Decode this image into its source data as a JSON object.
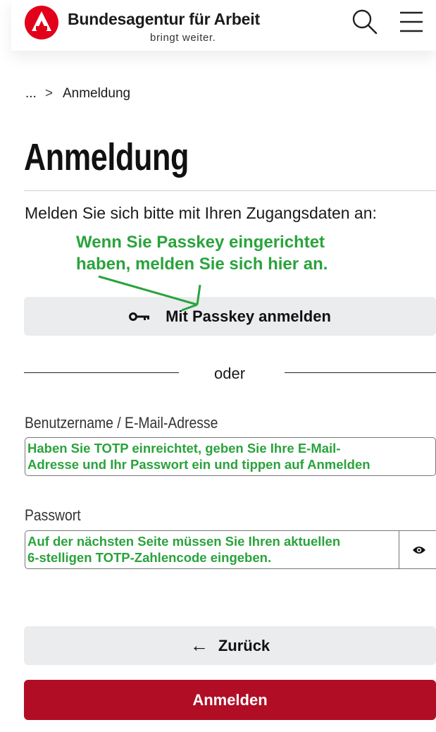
{
  "header": {
    "brand_name": "Bundesagentur für Arbeit",
    "brand_tagline": "bringt weiter.",
    "logo_icon": "ba-logo-icon",
    "search_icon": "search-icon",
    "menu_icon": "hamburger-menu-icon",
    "brand_color": "#e2001a"
  },
  "breadcrumb": {
    "ellipsis": "...",
    "separator": ">",
    "current": "Anmeldung"
  },
  "page": {
    "title": "Anmeldung",
    "intro": "Melden Sie sich bitte mit Ihren Zugangsdaten an:"
  },
  "annotations": {
    "passkey_line1": "Wenn Sie Passkey eingerichtet",
    "passkey_line2": "haben, melden Sie sich hier an.",
    "user_line1": "Haben Sie TOTP einreichtet, geben Sie Ihre E-Mail-",
    "user_line2": "Adresse und Ihr Passwort ein und tippen auf Anmelden",
    "pass_line1": "Auf der nächsten Seite müssen Sie Ihren aktuellen",
    "pass_line2": "6-stelligen TOTP-Zahlencode eingeben.",
    "annotation_color": "#2aa33c"
  },
  "passkey_button": {
    "label": "Mit Passkey anmelden",
    "icon": "key-icon"
  },
  "divider_text": "oder",
  "form": {
    "username_label": "Benutzername / E-Mail-Adresse",
    "username_value": "",
    "password_label": "Passwort",
    "password_value": "",
    "password_toggle_icon": "eye-icon"
  },
  "actions": {
    "back_arrow": "←",
    "back_label": "Zurück",
    "login_label": "Anmelden",
    "login_color": "#b10e26"
  }
}
